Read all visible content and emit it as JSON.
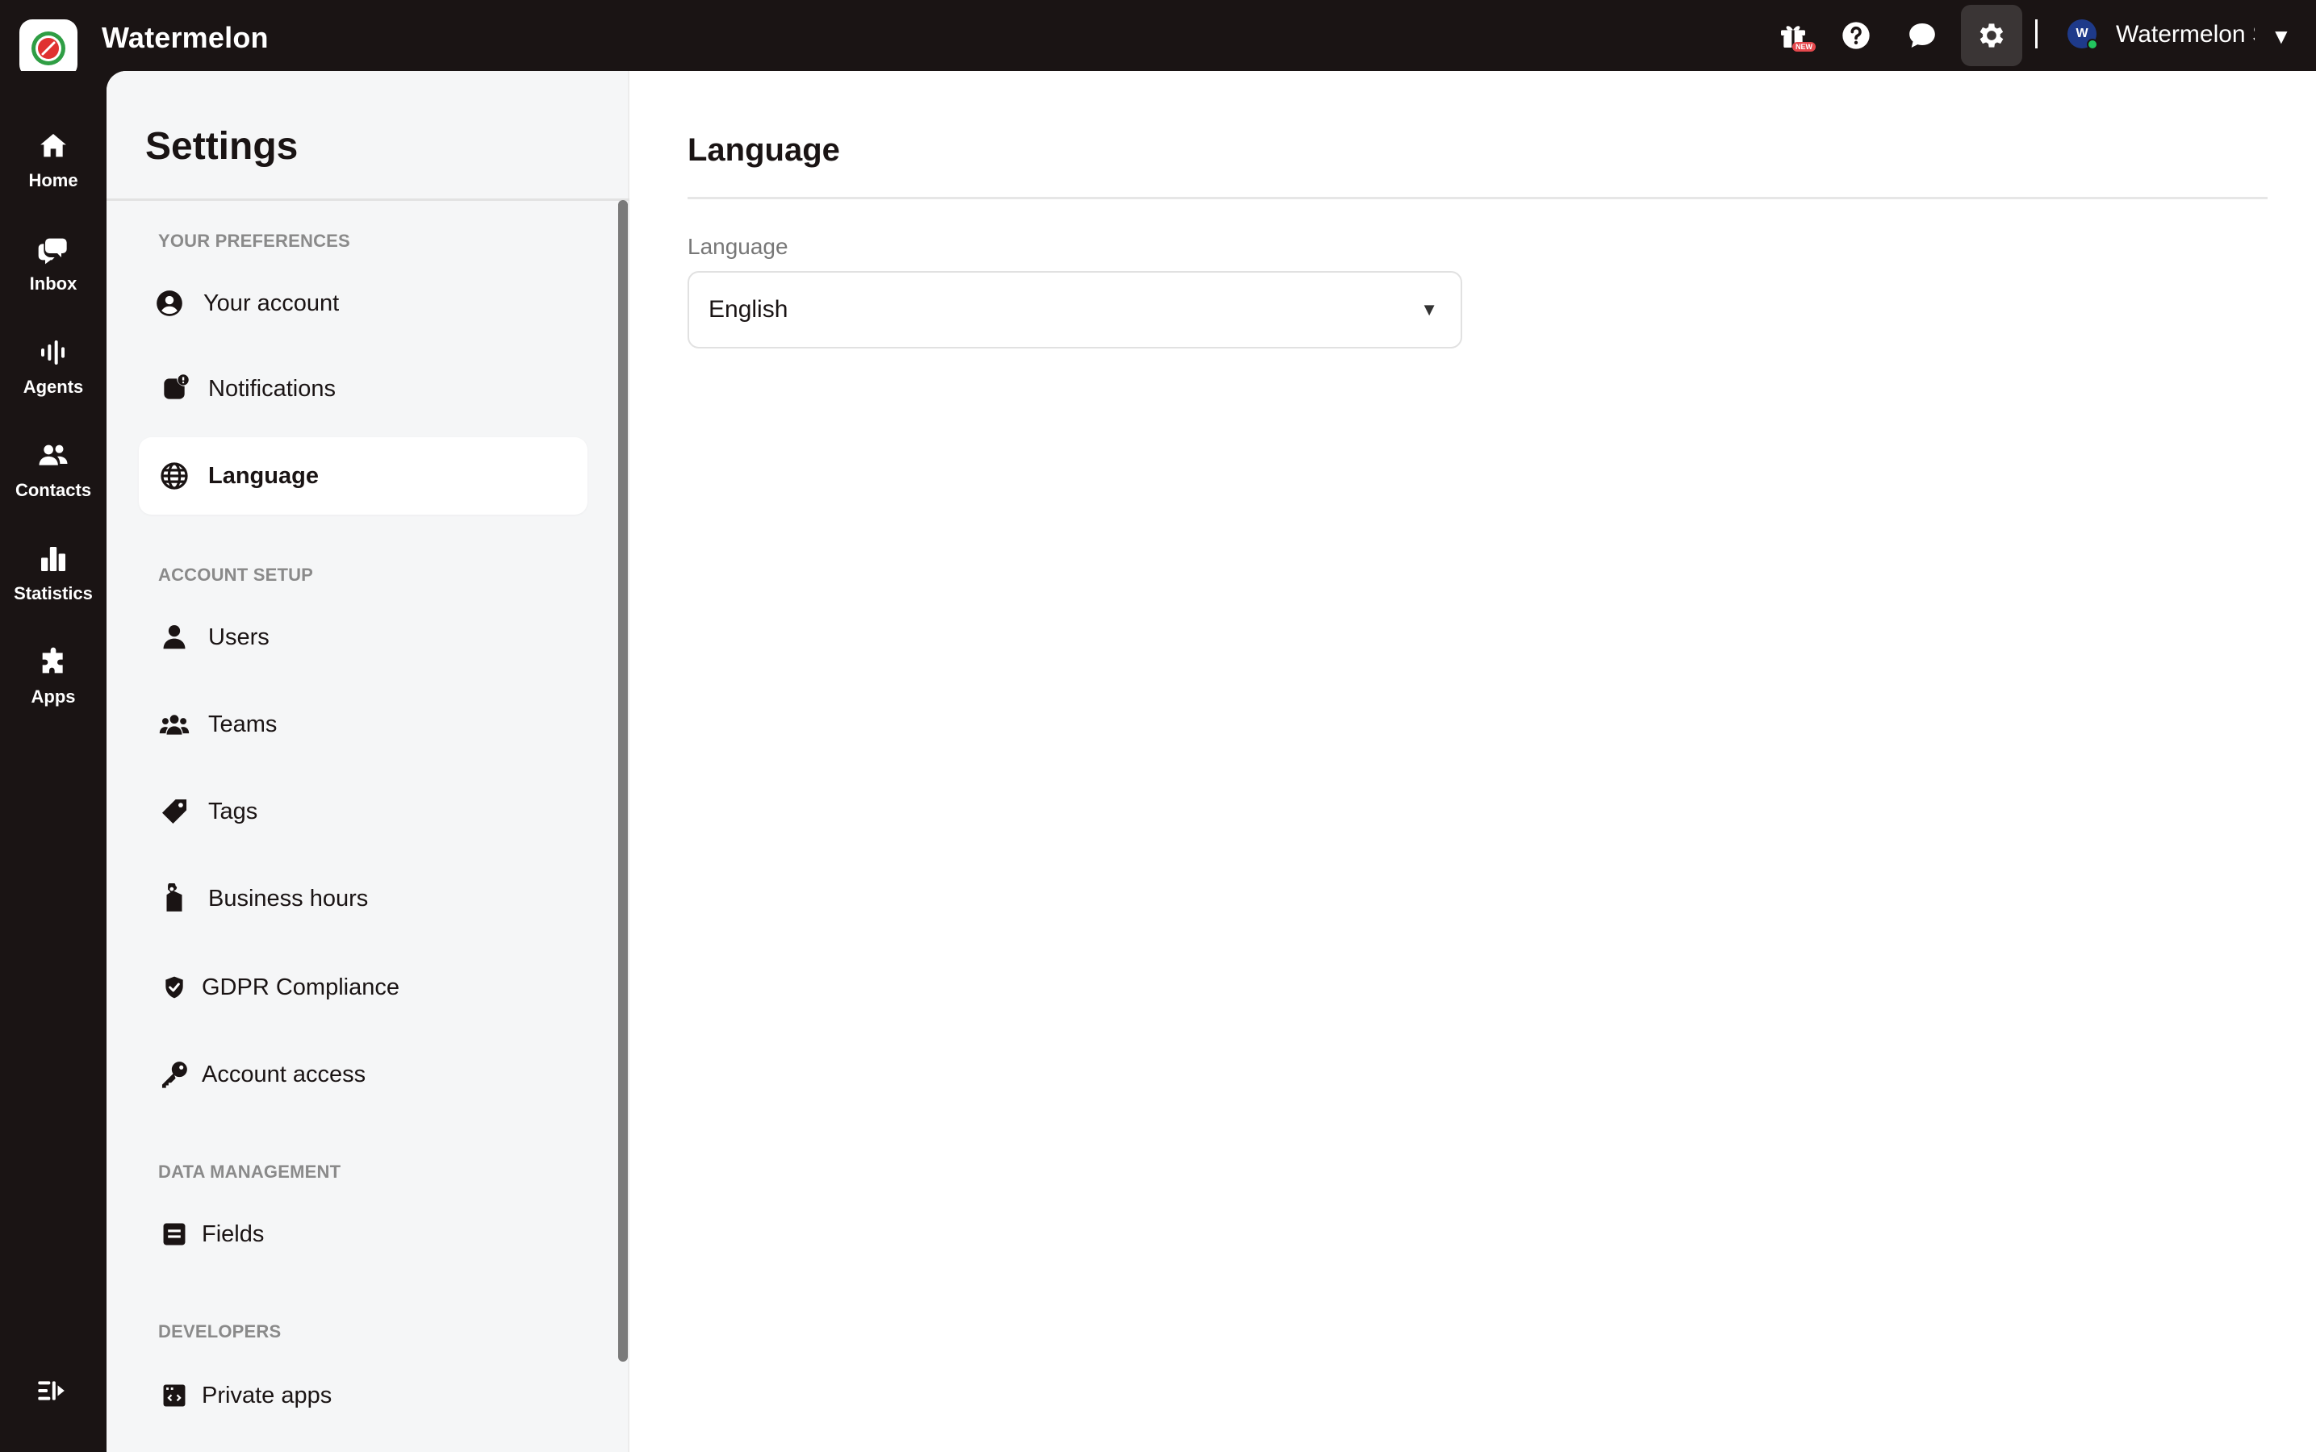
{
  "app": {
    "brand": "Watermelon",
    "account_name": "Watermelon S",
    "avatar_initial": "W",
    "new_badge": "NEW"
  },
  "topbar": {
    "icons": [
      "gift-icon",
      "help-icon",
      "chat-icon",
      "settings-icon"
    ],
    "caret": "▼"
  },
  "rail": {
    "items": [
      {
        "label": "Home",
        "icon": "home-icon"
      },
      {
        "label": "Inbox",
        "icon": "inbox-icon"
      },
      {
        "label": "Agents",
        "icon": "agents-icon"
      },
      {
        "label": "Contacts",
        "icon": "contacts-icon"
      },
      {
        "label": "Statistics",
        "icon": "statistics-icon"
      },
      {
        "label": "Apps",
        "icon": "apps-icon"
      }
    ]
  },
  "settings": {
    "title": "Settings",
    "sections": {
      "preferences": "YOUR PREFERENCES",
      "account_setup": "ACCOUNT SETUP",
      "data_management": "DATA MANAGEMENT",
      "developers": "DEVELOPERS"
    },
    "items": {
      "your_account": "Your account",
      "notifications": "Notifications",
      "language": "Language",
      "users": "Users",
      "teams": "Teams",
      "tags": "Tags",
      "business_hours": "Business hours",
      "gdpr": "GDPR Compliance",
      "account_access": "Account access",
      "fields": "Fields",
      "private_apps": "Private apps"
    }
  },
  "content": {
    "title": "Language",
    "field_label": "Language",
    "selected_language": "English",
    "caret": "▼"
  },
  "colors": {
    "dark": "#1a1414",
    "panel_bg": "#f5f6f7",
    "accent_green": "#22c55e",
    "badge_red": "#e5484d"
  }
}
